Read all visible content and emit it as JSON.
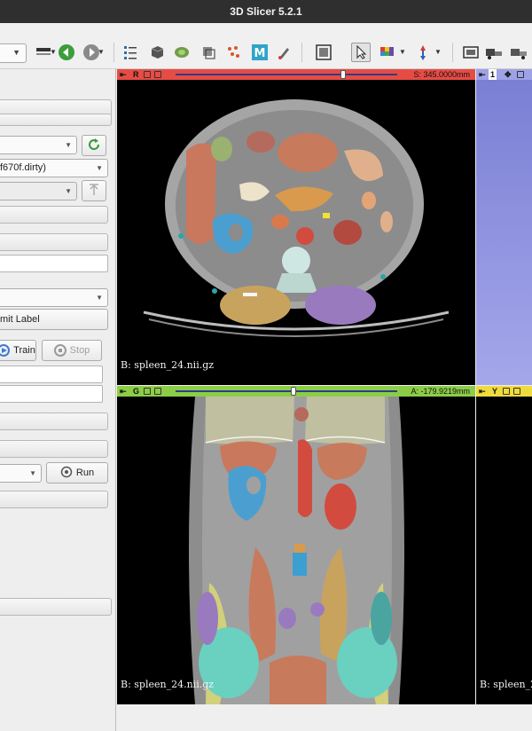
{
  "window": {
    "title": "3D Slicer 5.2.1"
  },
  "toolbar": {
    "icons": [
      "layout-icon",
      "back-arrow-icon",
      "forward-arrow-icon",
      "data-icon",
      "volumes-icon",
      "models-icon",
      "transforms-icon",
      "markups-icon",
      "monai-icon",
      "segment-editor-icon",
      "screenshot-icon",
      "mouse-pointer-icon",
      "colormap-icon",
      "place-fiducial-icon",
      "capture-icon",
      "extensions-icon",
      "python-icon"
    ]
  },
  "left_panel": {
    "version_combo": "f670f.dirty)",
    "commit_label_button": "mit Label",
    "train_button": "Train",
    "stop_button": "Stop",
    "run_button": "Run"
  },
  "views": {
    "red": {
      "letter": "R",
      "offset": "S: 345.0000mm",
      "slider_fraction": 0.73,
      "volume_label": "B: spleen_24.nii.gz",
      "color": "#e54a41"
    },
    "green": {
      "letter": "G",
      "offset": "A: -179.9219mm",
      "slider_fraction": 0.5,
      "volume_label": "B: spleen_24.nii.gz",
      "color": "#7fc344"
    },
    "yellow": {
      "letter": "Y",
      "volume_label": "B: spleen_2",
      "color": "#eed93b"
    },
    "threed": {
      "letter": "1",
      "color": "#8c8fd8"
    }
  },
  "colors": {
    "spleen": "#c87a5d",
    "liver": "#c56a4f",
    "kidney": "#4a9fd0",
    "aorta": "#d24b3f",
    "bone": "#cfe7e3",
    "muscle": "#9a7abf"
  }
}
